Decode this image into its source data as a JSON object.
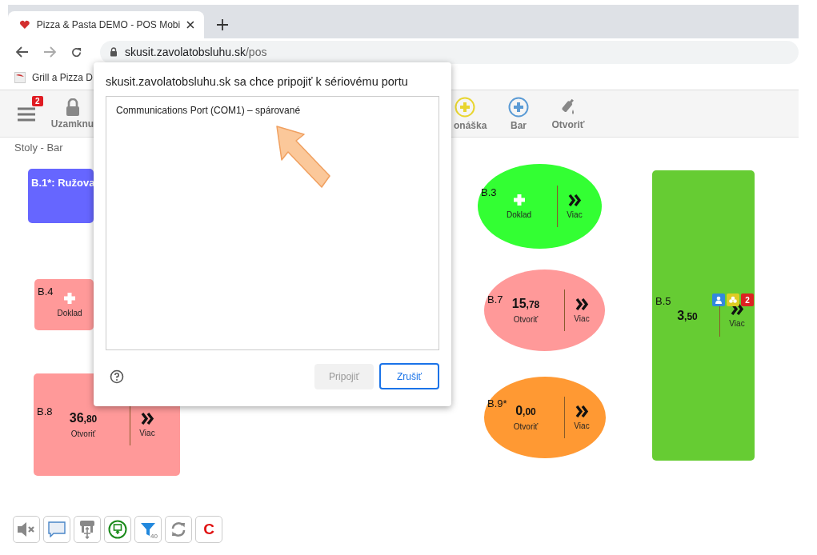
{
  "browser": {
    "tab_title": "Pizza & Pasta DEMO - POS Mobi",
    "url_domain": "skusit.zavolatobsluhu.sk",
    "url_path": "/pos",
    "bookmark": "Grill a Pizza D"
  },
  "toolbar": {
    "menu_badge": "2",
    "items": [
      {
        "kind": "lock",
        "label": "Uzamknu"
      },
      {
        "kind": "plus-yellow",
        "label": "onáška"
      },
      {
        "kind": "plus-blue",
        "label": "Bar"
      },
      {
        "kind": "bottle",
        "label": "Otvoriť"
      }
    ]
  },
  "breadcrumb": "Stoly - Bar",
  "tables": [
    {
      "name": "B.1*: Ružova",
      "kind": "rect",
      "color": "#6666ff"
    },
    {
      "name": "B.4",
      "kind": "rect",
      "color": "#ff9999",
      "action": "Doklad"
    },
    {
      "name": "B.8",
      "kind": "rect",
      "color": "#ff9999",
      "amount": "36,80",
      "action": "Otvoriť",
      "more": "Viac"
    },
    {
      "name": "B.3",
      "kind": "ellipse",
      "color": "#33ff33",
      "action": "Doklad",
      "more": "Viac"
    },
    {
      "name": "B.7",
      "kind": "ellipse",
      "color": "#ff9999",
      "amount": "15,78",
      "action": "Otvoriť",
      "more": "Viac"
    },
    {
      "name": "B.9*",
      "kind": "ellipse",
      "color": "#ff9933",
      "amount": "0,00",
      "action": "Otvoriť",
      "more": "Viac"
    },
    {
      "name": "B.5",
      "kind": "rect",
      "color": "#66cc33",
      "amount": "3,50",
      "more": "Viac",
      "badges": [
        {
          "kind": "person",
          "color": "#3388dd"
        },
        {
          "kind": "group",
          "color": "#ddcc22"
        },
        {
          "kind": "count",
          "text": "2",
          "color": "#dd2222"
        }
      ]
    }
  ],
  "bottom_tools": [
    {
      "kind": "mute"
    },
    {
      "kind": "chat"
    },
    {
      "kind": "move-table"
    },
    {
      "kind": "screen"
    },
    {
      "kind": "filter",
      "text": "40"
    },
    {
      "kind": "refresh"
    },
    {
      "kind": "letter",
      "text": "C"
    }
  ],
  "dialog": {
    "title": "skusit.zavolatobsluhu.sk sa chce pripojiť k sériovému portu",
    "ports": [
      {
        "label": "Communications Port (COM1) – spárované",
        "selected": false
      }
    ],
    "connect": {
      "label": "Pripojiť",
      "disabled": true
    },
    "cancel": {
      "label": "Zrušiť"
    }
  }
}
